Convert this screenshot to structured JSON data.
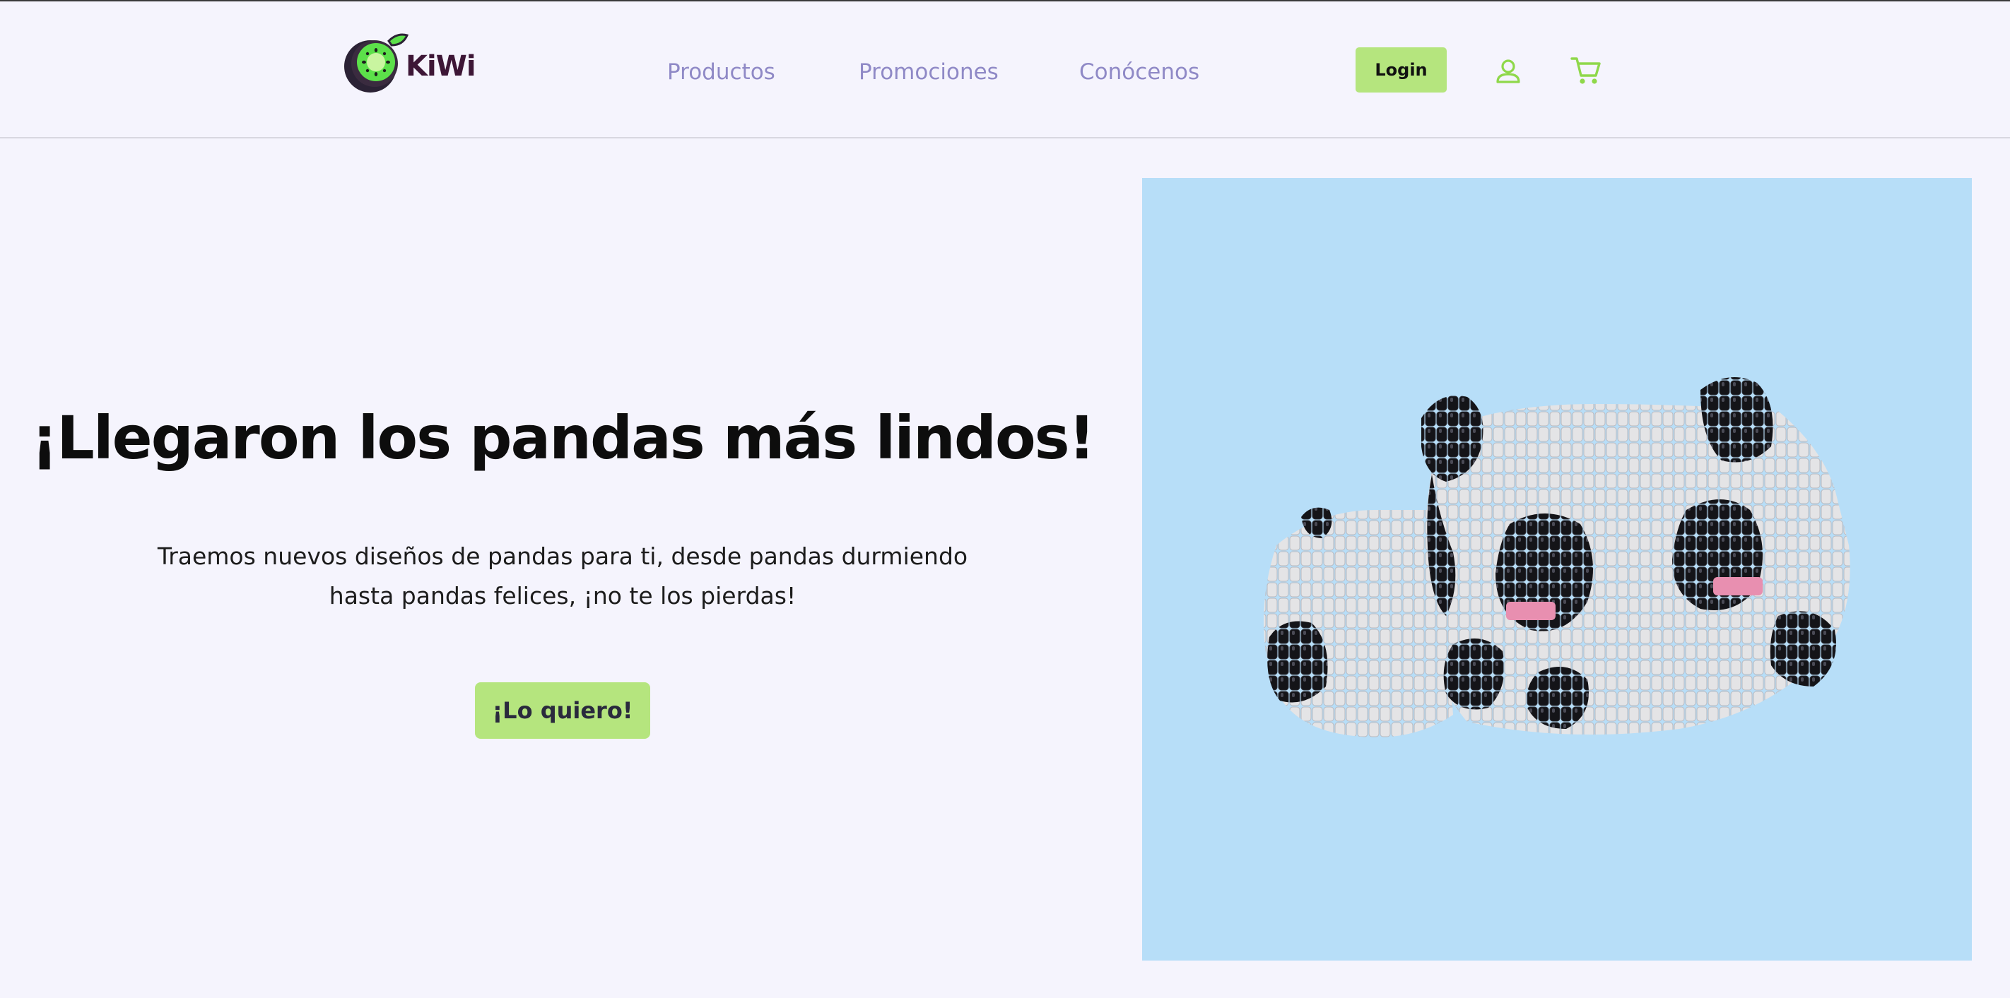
{
  "brand": {
    "name": "KiWi",
    "logo_icon": "kiwi-fruit-icon",
    "colors": {
      "accent_green": "#b5e57e",
      "kiwi_green": "#5ce04a",
      "nav_text": "#8f89c6",
      "page_background": "#f5f4fd",
      "image_background": "#b7def8"
    }
  },
  "nav": {
    "items": [
      {
        "label": "Productos"
      },
      {
        "label": "Promociones"
      },
      {
        "label": "Conócenos"
      }
    ],
    "login_label": "Login",
    "user_icon": "user-icon",
    "cart_icon": "shopping-cart-icon"
  },
  "hero": {
    "title": "¡Llegaron los pandas más lindos!",
    "subtitle": "Traemos nuevos diseños de pandas para ti, desde pandas durmiendo hasta pandas felices, ¡no te los pierdas!",
    "cta_label": "¡Lo quiero!",
    "image_subject": "beaded-panda-image"
  }
}
